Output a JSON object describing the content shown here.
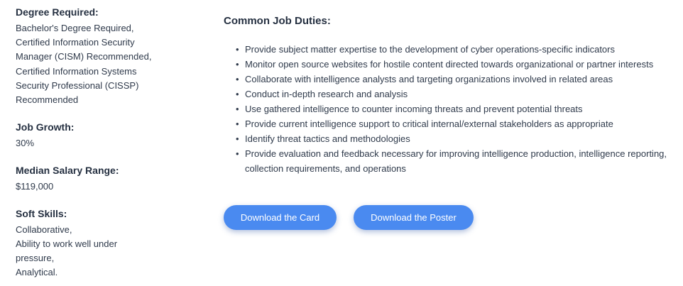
{
  "left": {
    "degree": {
      "title": "Degree Required:",
      "lines": [
        "Bachelor's Degree Required,",
        "Certified Information Security",
        "Manager (CISM) Recommended,",
        "Certified Information Systems",
        "Security Professional (CISSP)",
        "Recommended"
      ]
    },
    "growth": {
      "title": "Job Growth:",
      "value": "30%"
    },
    "salary": {
      "title": "Median Salary Range:",
      "value": "$119,000"
    },
    "soft_skills": {
      "title": "Soft Skills:",
      "lines": [
        "Collaborative,",
        "Ability to work well under",
        "pressure,",
        "Analytical."
      ]
    }
  },
  "duties": {
    "title": "Common Job Duties:",
    "items": [
      "Provide subject matter expertise to the development of cyber operations-specific indicators",
      "Monitor open source websites for hostile content directed towards organizational or partner interests",
      "Collaborate with intelligence analysts and targeting organizations involved in related areas",
      "Conduct in-depth research and analysis",
      "Use gathered intelligence to counter incoming threats and prevent potential threats",
      "Provide current intelligence support to critical internal/external stakeholders as appropriate",
      "Identify threat tactics and methodologies",
      "Provide evaluation and feedback necessary for improving intelligence production, intelligence reporting,",
      "collection requirements, and operations"
    ]
  },
  "buttons": {
    "card": "Download the Card",
    "poster": "Download the Poster"
  },
  "colors": {
    "button": "#4a8af0",
    "text": "#2f3a4b"
  }
}
